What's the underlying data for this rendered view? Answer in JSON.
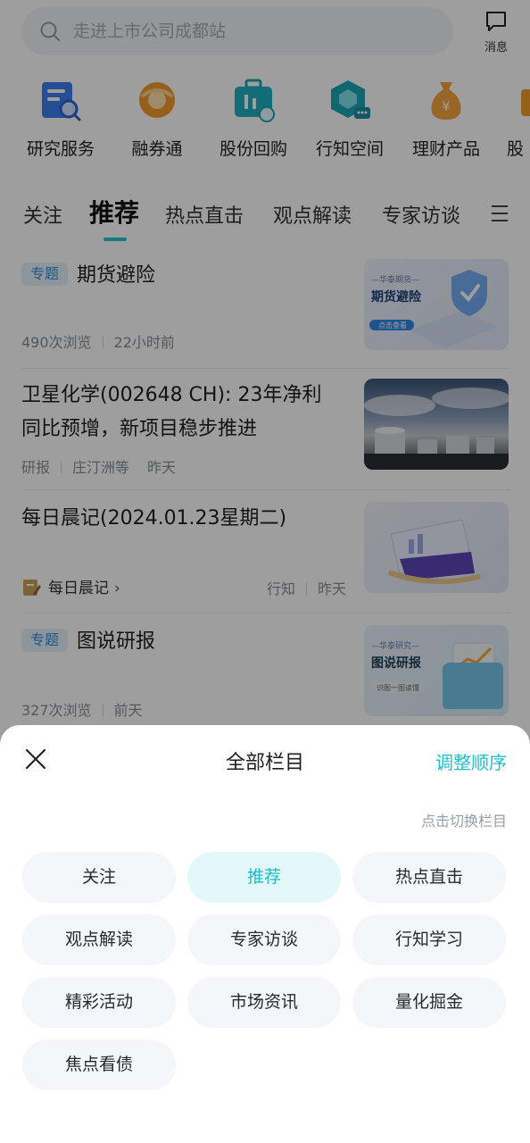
{
  "search": {
    "placeholder": "走进上市公司成都站"
  },
  "messages": {
    "label": "消息"
  },
  "quick_services": [
    {
      "label": "研究服务",
      "icon": "research-report-icon"
    },
    {
      "label": "融券通",
      "icon": "coin-ring-icon"
    },
    {
      "label": "股份回购",
      "icon": "briefcase-chart-icon"
    },
    {
      "label": "行知空间",
      "icon": "cube-chat-icon"
    },
    {
      "label": "理财产品",
      "icon": "money-bag-icon"
    },
    {
      "label": "股",
      "icon": "partial-icon"
    }
  ],
  "tabs": [
    "关注",
    "推荐",
    "热点直击",
    "观点解读",
    "专家访谈"
  ],
  "active_tab": "推荐",
  "feed": {
    "items": [
      {
        "badge": "专题",
        "title": "期货避险",
        "views": "490次浏览",
        "time": "22小时前",
        "thumb": {
          "kicker": "—华泰期货—",
          "title": "期货避险",
          "button": "点击查看"
        }
      },
      {
        "title_line1": "卫星化学(002648 CH): 23年净利",
        "title_line2": "同比预增，新项目稳步推进",
        "type": "研报",
        "author": "庄汀洲等",
        "time": "昨天"
      },
      {
        "title": "每日晨记(2024.01.23星期二)",
        "column": "每日晨记",
        "source": "行知",
        "time": "昨天"
      },
      {
        "badge": "专题",
        "title": "图说研报",
        "views": "327次浏览",
        "time": "前天",
        "thumb": {
          "kicker": "—华泰研究—",
          "title": "图说研报",
          "button": "识图一图读懂"
        }
      }
    ]
  },
  "sheet": {
    "title": "全部栏目",
    "reorder_label": "调整顺序",
    "hint": "点击切换栏目",
    "channels": [
      "关注",
      "推荐",
      "热点直击",
      "观点解读",
      "专家访谈",
      "行知学习",
      "精彩活动",
      "市场资讯",
      "量化掘金",
      "焦点看债"
    ],
    "selected": "推荐"
  },
  "colors": {
    "accent": "#20c0cc",
    "selected_chip_bg": "#e4f8fa",
    "badge_text": "#2d8fd8"
  }
}
